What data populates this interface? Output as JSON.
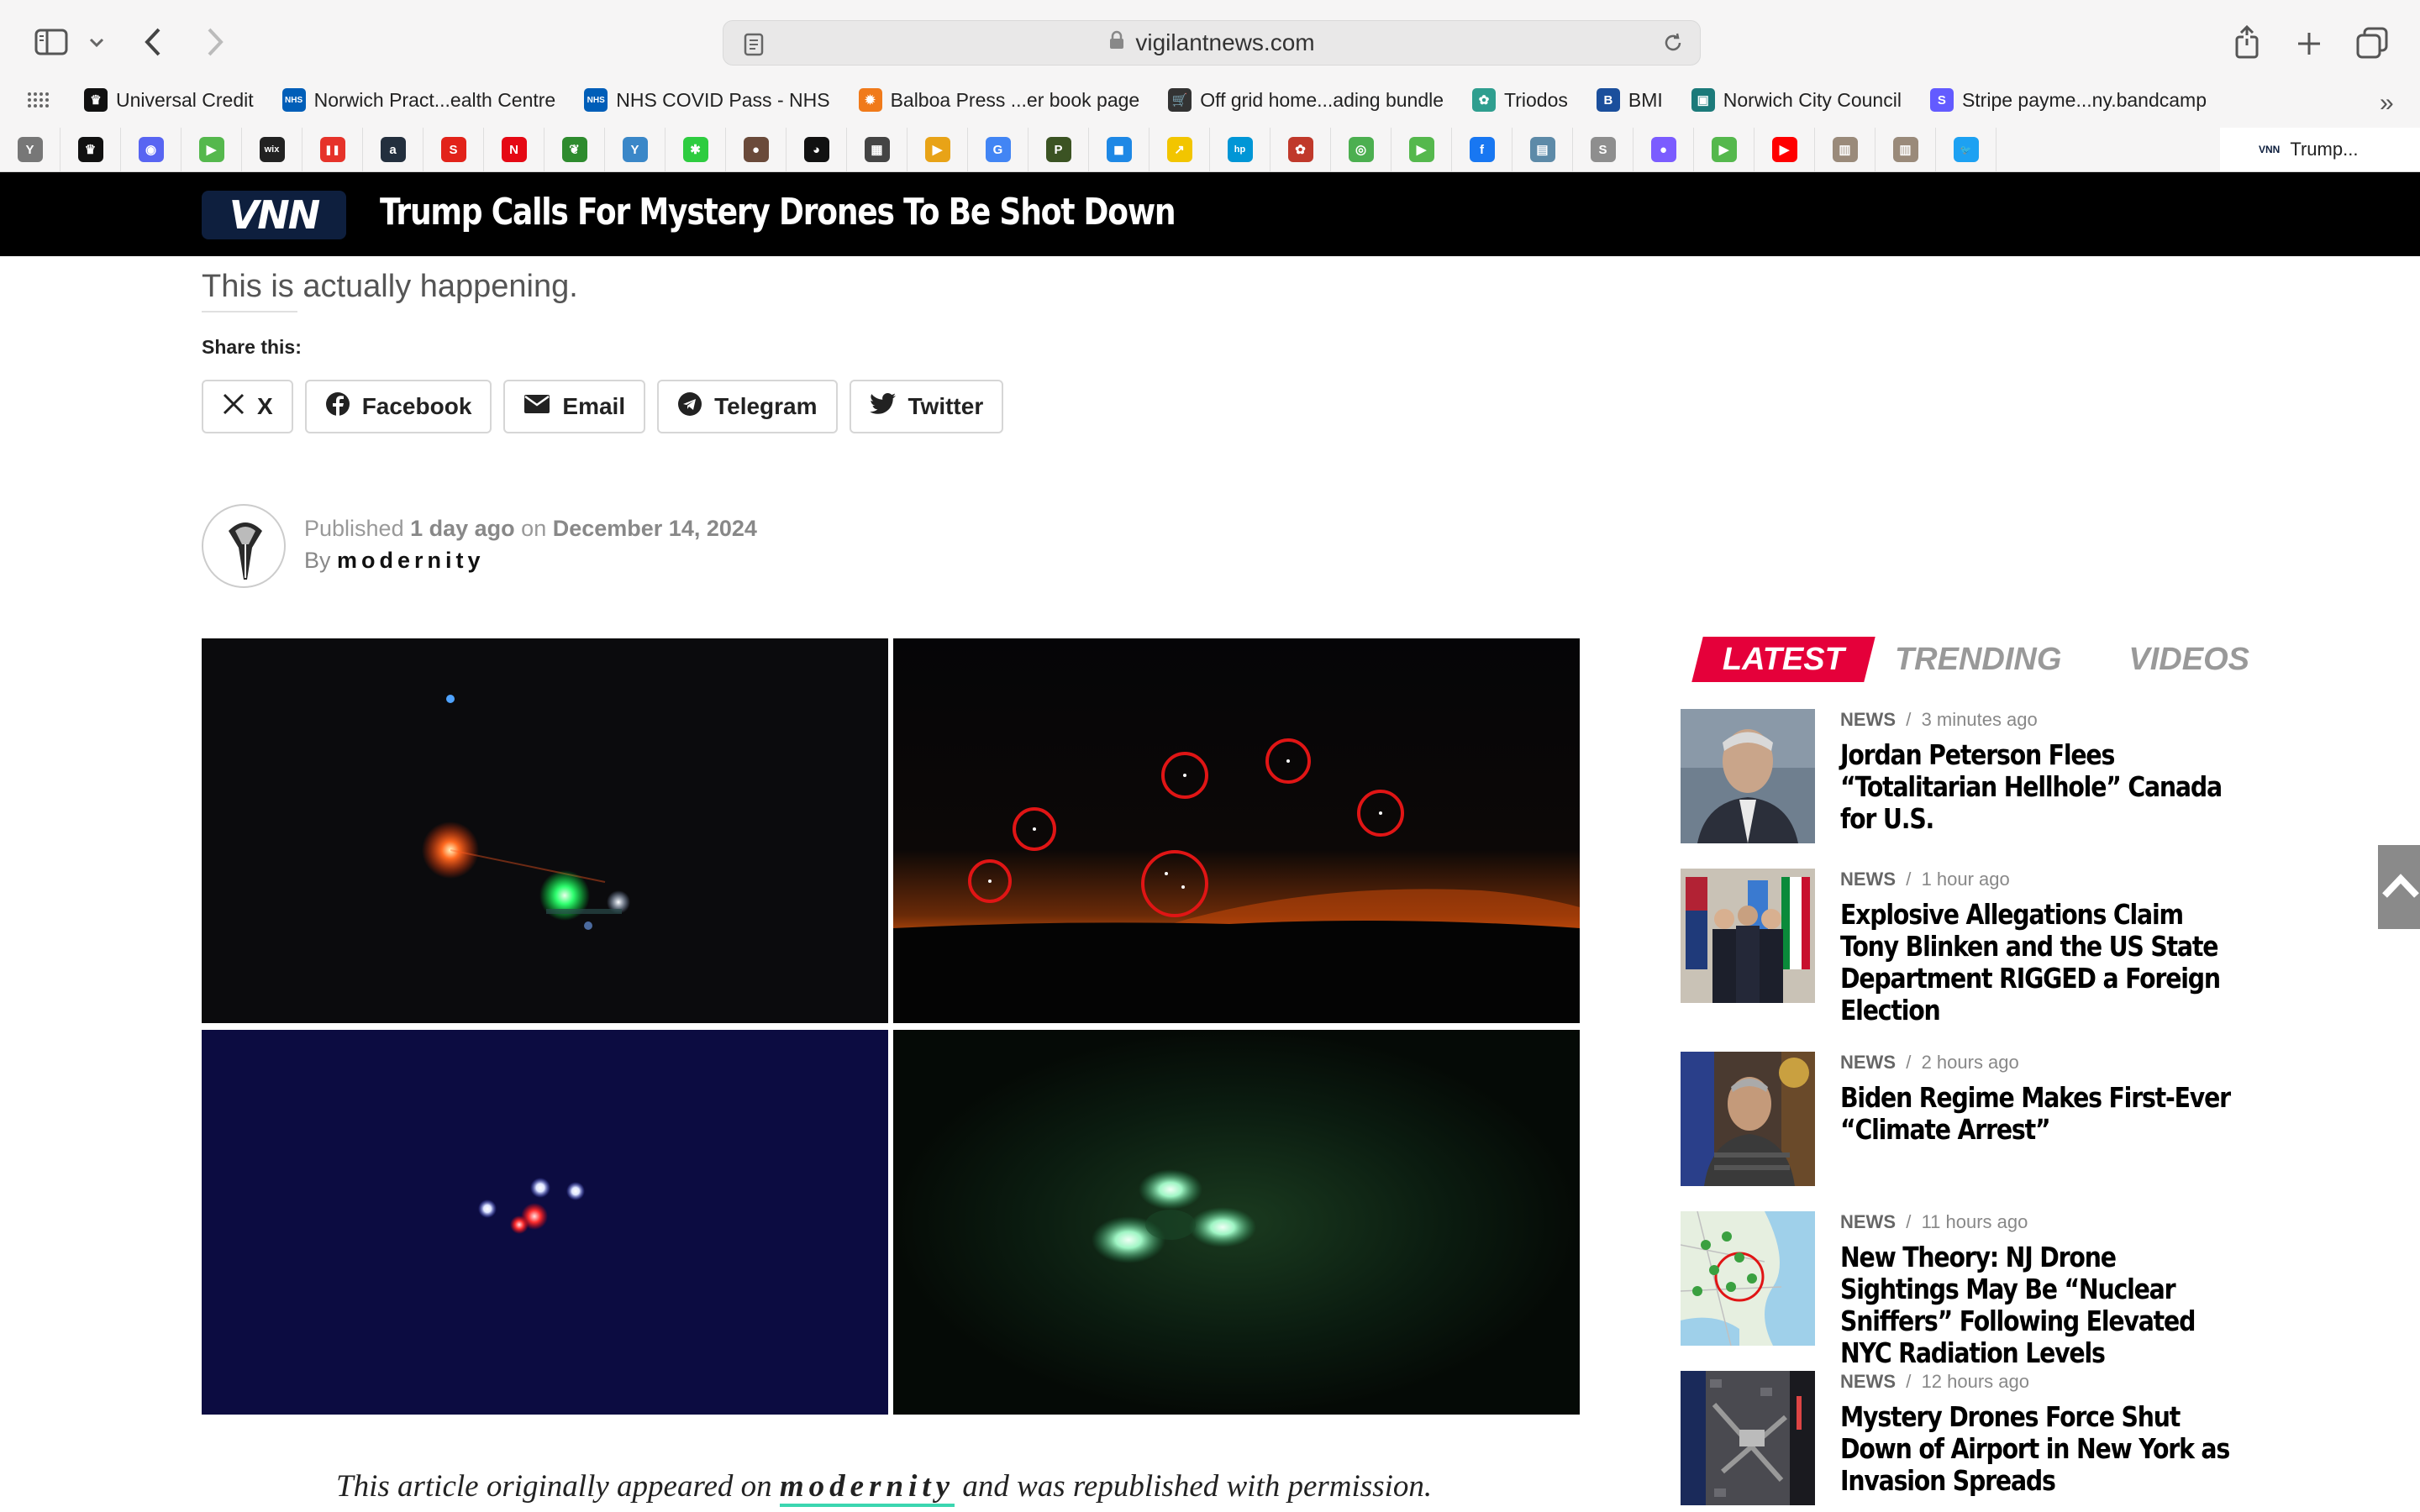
{
  "browser": {
    "url": "vigilantnews.com",
    "bookmarks": [
      {
        "label": "Universal Credit",
        "color": "#111111",
        "glyph": "♛"
      },
      {
        "label": "Norwich Pract...ealth Centre",
        "color": "#005eb8",
        "glyph": "NHS"
      },
      {
        "label": "NHS COVID Pass - NHS",
        "color": "#005eb8",
        "glyph": "NHS"
      },
      {
        "label": "Balboa Press ...er book page",
        "color": "#f07a1a",
        "glyph": "✹"
      },
      {
        "label": "Off grid home...ading bundle",
        "color": "#333333",
        "glyph": "🛒"
      },
      {
        "label": "Triodos",
        "color": "#2f9e8f",
        "glyph": "✿"
      },
      {
        "label": "BMI",
        "color": "#1b4f9c",
        "glyph": "B"
      },
      {
        "label": "Norwich City Council",
        "color": "#1c7a7a",
        "glyph": "▣"
      },
      {
        "label": "Stripe payme...ny.bandcamp",
        "color": "#635bff",
        "glyph": "S"
      }
    ],
    "favicons": [
      {
        "name": "y-favicon",
        "color": "#777777",
        "glyph": "Y"
      },
      {
        "name": "crown-favicon",
        "color": "#111111",
        "glyph": "♛"
      },
      {
        "name": "discord-favicon",
        "color": "#5865f2",
        "glyph": "◉"
      },
      {
        "name": "play-favicon",
        "color": "#55b84d",
        "glyph": "▶"
      },
      {
        "name": "wix-favicon",
        "color": "#222222",
        "glyph": "wix"
      },
      {
        "name": "pause-favicon",
        "color": "#e6332a",
        "glyph": "❚❚"
      },
      {
        "name": "amazon-favicon",
        "color": "#232f3e",
        "glyph": "a"
      },
      {
        "name": "s-favicon",
        "color": "#e2231a",
        "glyph": "S"
      },
      {
        "name": "netflix-favicon",
        "color": "#e50914",
        "glyph": "N"
      },
      {
        "name": "leaf-favicon",
        "color": "#2e8b2e",
        "glyph": "❦"
      },
      {
        "name": "y-arrow-favicon",
        "color": "#3a87c8",
        "glyph": "Y"
      },
      {
        "name": "star-favicon",
        "color": "#2ecc40",
        "glyph": "✱"
      },
      {
        "name": "face-favicon",
        "color": "#6a4a3a",
        "glyph": "●"
      },
      {
        "name": "alien-favicon",
        "color": "#111111",
        "glyph": "◕"
      },
      {
        "name": "photo-favicon",
        "color": "#444444",
        "glyph": "▦"
      },
      {
        "name": "folder-favicon",
        "color": "#e8a317",
        "glyph": "▶"
      },
      {
        "name": "google-favicon",
        "color": "#4285f4",
        "glyph": "G"
      },
      {
        "name": "p-favicon",
        "color": "#3b5323",
        "glyph": "P"
      },
      {
        "name": "chat-favicon",
        "color": "#1e88e5",
        "glyph": "◼"
      },
      {
        "name": "arrow-favicon",
        "color": "#f2c500",
        "glyph": "↗"
      },
      {
        "name": "hp-favicon",
        "color": "#0096d6",
        "glyph": "hp"
      },
      {
        "name": "poppy-favicon",
        "color": "#c0392b",
        "glyph": "✿"
      },
      {
        "name": "circle-favicon",
        "color": "#4caf50",
        "glyph": "◎"
      },
      {
        "name": "play2-favicon",
        "color": "#55b84d",
        "glyph": "▶"
      },
      {
        "name": "facebook-favicon",
        "color": "#1877f2",
        "glyph": "f"
      },
      {
        "name": "landscape-favicon",
        "color": "#5d8aa8",
        "glyph": "▤"
      },
      {
        "name": "s2-favicon",
        "color": "#8e8e8e",
        "glyph": "S"
      },
      {
        "name": "dot-favicon",
        "color": "#7b5cff",
        "glyph": "●"
      },
      {
        "name": "play3-favicon",
        "color": "#55b84d",
        "glyph": "▶"
      },
      {
        "name": "youtube-favicon",
        "color": "#ff0000",
        "glyph": "▶"
      },
      {
        "name": "portrait-favicon",
        "color": "#9a8a7a",
        "glyph": "▥"
      },
      {
        "name": "portrait2-favicon",
        "color": "#9a8a7a",
        "glyph": "▥"
      },
      {
        "name": "twitter-favicon",
        "color": "#1da1f2",
        "glyph": "🐦"
      }
    ],
    "active_tab_label": "Trump..."
  },
  "site": {
    "logo_text": "VNN",
    "header_title": "Trump Calls For Mystery Drones To Be Shot Down"
  },
  "article": {
    "subtitle": "This is actually happening.",
    "share_label": "Share this:",
    "share_buttons": [
      "X",
      "Facebook",
      "Email",
      "Telegram",
      "Twitter"
    ],
    "published_prefix": "Published",
    "published_relative": "1 day ago",
    "published_on": "on",
    "published_date": "December 14, 2024",
    "by_prefix": "By",
    "author": "modernity",
    "footer_prefix": "This article originally appeared on",
    "footer_source": "modernity",
    "footer_suffix": "and was republished with permission."
  },
  "sidebar": {
    "tabs": [
      "LATEST",
      "TRENDING",
      "VIDEOS"
    ],
    "items": [
      {
        "category": "NEWS",
        "time": "3 minutes ago",
        "title": "Jordan Peterson Flees “Totalitarian Hellhole” Canada for U.S."
      },
      {
        "category": "NEWS",
        "time": "1 hour ago",
        "title": "Explosive Allegations Claim Tony Blinken and the US State Department RIGGED a Foreign Election"
      },
      {
        "category": "NEWS",
        "time": "2 hours ago",
        "title": "Biden Regime Makes First-Ever “Climate Arrest”"
      },
      {
        "category": "NEWS",
        "time": "11 hours ago",
        "title": "New Theory: NJ Drone Sightings May Be “Nuclear Sniffers” Following Elevated NYC Radiation Levels"
      },
      {
        "category": "NEWS",
        "time": "12 hours ago",
        "title": "Mystery Drones Force Shut Down of Airport in New York as Invasion Spreads"
      }
    ]
  },
  "colors": {
    "accent": "#e5003a",
    "header_bg": "#000000",
    "footer_underline": "#3bd6b0"
  }
}
